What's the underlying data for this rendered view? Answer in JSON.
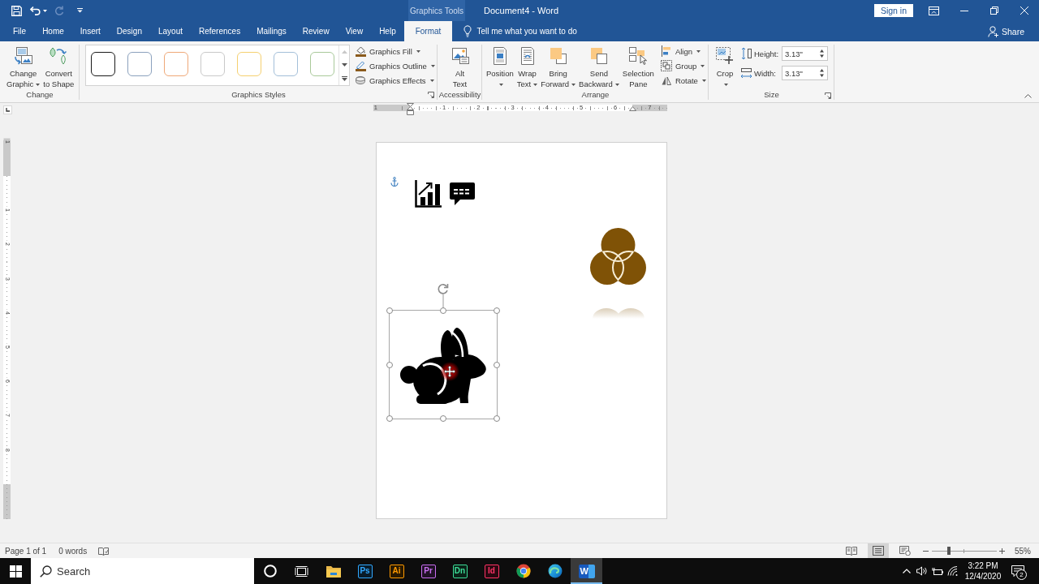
{
  "window": {
    "title": "Document4 - Word",
    "contextual_label": "Graphics Tools",
    "sign_in": "Sign in"
  },
  "quick_access": [
    {
      "kind": "save",
      "disabled": false
    },
    {
      "kind": "undo",
      "disabled": false
    },
    {
      "kind": "redo",
      "disabled": true
    },
    {
      "kind": "customize",
      "disabled": false
    }
  ],
  "tabs": [
    {
      "label": "File",
      "selected": false
    },
    {
      "label": "Home",
      "selected": false
    },
    {
      "label": "Insert",
      "selected": false
    },
    {
      "label": "Design",
      "selected": false
    },
    {
      "label": "Layout",
      "selected": false
    },
    {
      "label": "References",
      "selected": false
    },
    {
      "label": "Mailings",
      "selected": false
    },
    {
      "label": "Review",
      "selected": false
    },
    {
      "label": "View",
      "selected": false
    },
    {
      "label": "Help",
      "selected": false
    },
    {
      "label": "Format",
      "selected": true
    }
  ],
  "tell_me": {
    "placeholder": "Tell me what you want to do"
  },
  "share": "Share",
  "ribbon": {
    "change": {
      "label": "Change",
      "launcher": false,
      "buttons": [
        {
          "lines": [
            "Change",
            "Graphic"
          ],
          "dropdown": true
        },
        {
          "lines": [
            "Convert",
            "to Shape"
          ],
          "dropdown": false
        }
      ]
    },
    "graphics_styles": {
      "label": "Graphics Styles",
      "launcher": true,
      "styles": [
        {
          "color": "#1a1a1a",
          "selected": false
        },
        {
          "color": "#8ba1bd",
          "selected": false
        },
        {
          "color": "#efa878",
          "selected": false
        },
        {
          "color": "#c9c9c9",
          "selected": false
        },
        {
          "color": "#f5d070",
          "selected": false
        },
        {
          "color": "#a3bfd9",
          "selected": false
        },
        {
          "color": "#a9c99a",
          "selected": false
        }
      ],
      "gallery_scroll": [
        {
          "kind": "up",
          "disabled": true
        },
        {
          "kind": "down",
          "disabled": false
        },
        {
          "kind": "more",
          "disabled": false
        }
      ],
      "commands": [
        {
          "label": "Graphics Fill",
          "dropdown": true
        },
        {
          "label": "Graphics Outline",
          "dropdown": true
        },
        {
          "label": "Graphics Effects",
          "dropdown": true
        }
      ]
    },
    "accessibility": {
      "label": "Accessibility",
      "launcher": false,
      "buttons": [
        {
          "lines": [
            "Alt",
            "Text"
          ],
          "dropdown": false
        }
      ]
    },
    "arrange": {
      "label": "Arrange",
      "launcher": false,
      "buttons": [
        {
          "lines": [
            "Position"
          ],
          "dropdown": true
        },
        {
          "lines": [
            "Wrap",
            "Text"
          ],
          "dropdown": true
        },
        {
          "lines": [
            "Bring",
            "Forward"
          ],
          "dropdown": true
        },
        {
          "lines": [
            "Send",
            "Backward"
          ],
          "dropdown": true
        },
        {
          "lines": [
            "Selection",
            "Pane"
          ],
          "dropdown": false
        }
      ],
      "commands": [
        {
          "label": "Align",
          "dropdown": true
        },
        {
          "label": "Group",
          "dropdown": true
        },
        {
          "label": "Rotate",
          "dropdown": true
        }
      ]
    },
    "size": {
      "label": "Size",
      "launcher": true,
      "buttons": [
        {
          "lines": [
            "Crop"
          ],
          "dropdown": true
        }
      ],
      "fields": [
        {
          "label": "Height:",
          "value": "3.13\""
        },
        {
          "label": "Width:",
          "value": "3.13\""
        }
      ]
    }
  },
  "ruler": {
    "horizontal": [
      "1",
      "1",
      "2",
      "3",
      "4",
      "5",
      "6",
      "7"
    ],
    "vertical": [
      "1",
      "1",
      "2",
      "3",
      "4",
      "5",
      "6",
      "7",
      "8"
    ]
  },
  "document": {
    "graphics": [
      {
        "kind": "chart",
        "color": "#000000",
        "selected": false,
        "reflection": false
      },
      {
        "kind": "caption",
        "color": "#000000",
        "selected": false,
        "reflection": false
      },
      {
        "kind": "venn",
        "color": "#7f5206",
        "selected": false,
        "reflection": true
      },
      {
        "kind": "rabbit",
        "color": "#000000",
        "selected": true,
        "reflection": false
      }
    ]
  },
  "status_bar": {
    "page": "Page 1 of 1",
    "words": "0 words",
    "views": [
      {
        "kind": "read",
        "selected": false
      },
      {
        "kind": "print",
        "selected": true
      },
      {
        "kind": "web",
        "selected": false
      }
    ],
    "zoom": {
      "level": 0.26,
      "reading": "55%"
    }
  },
  "taskbar": {
    "search": {
      "placeholder": "Search"
    },
    "apps": [
      {
        "kind": "cortana",
        "active": false
      },
      {
        "kind": "task_view",
        "active": false
      },
      {
        "kind": "explorer",
        "active": false
      },
      {
        "kind": "tile",
        "label": "Ps",
        "color": "#31a8ff",
        "active": false
      },
      {
        "kind": "tile",
        "label": "Ai",
        "color": "#ff9a00",
        "active": false
      },
      {
        "kind": "tile",
        "label": "Pr",
        "color": "#c86ef0",
        "active": false
      },
      {
        "kind": "tile",
        "label": "Dn",
        "color": "#3ddc97",
        "active": false
      },
      {
        "kind": "tile",
        "label": "Id",
        "color": "#ff3366",
        "active": false
      },
      {
        "kind": "chrome",
        "active": false
      },
      {
        "kind": "edge",
        "active": false
      },
      {
        "kind": "word",
        "label": "W",
        "active": true
      }
    ],
    "clock": {
      "time": "3:22 PM",
      "date": "12/4/2020"
    },
    "notifications": "2"
  }
}
